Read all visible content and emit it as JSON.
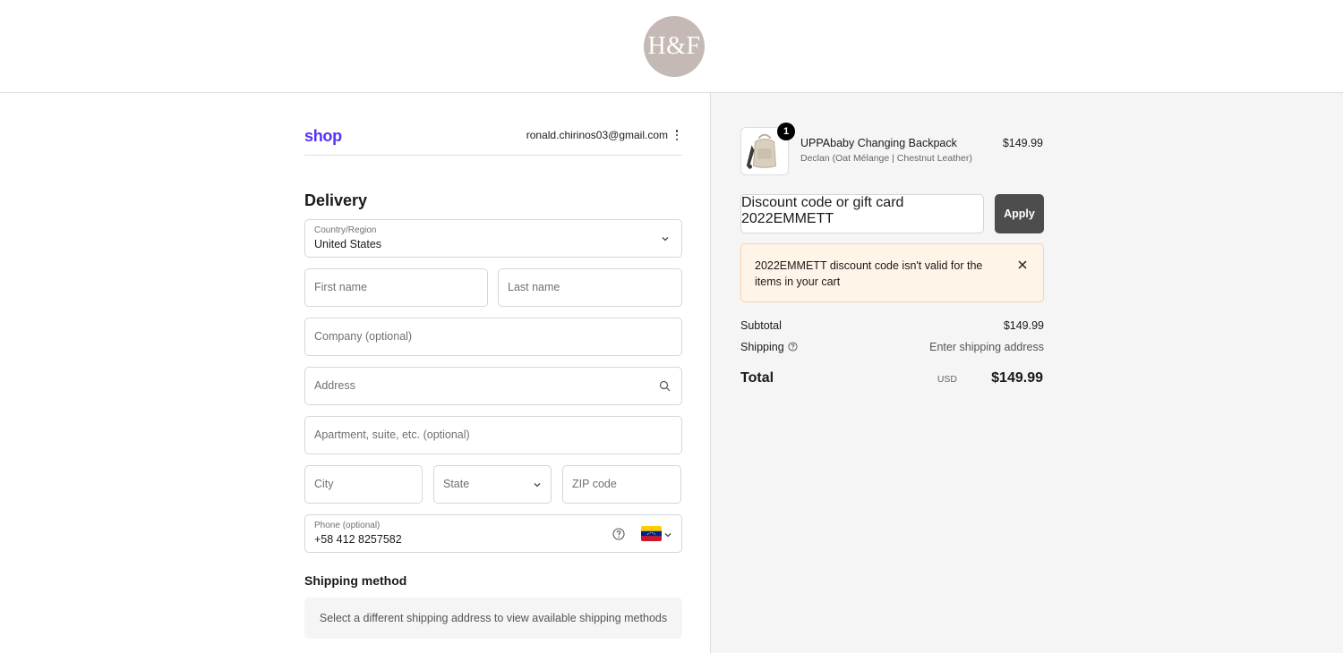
{
  "header": {
    "logo_text": "H&F"
  },
  "express": {
    "shop_label": "shop",
    "account_email": "ronald.chirinos03@gmail.com"
  },
  "delivery": {
    "title": "Delivery",
    "country": {
      "label": "Country/Region",
      "value": "United States"
    },
    "first_name": {
      "placeholder": "First name"
    },
    "last_name": {
      "placeholder": "Last name"
    },
    "company": {
      "placeholder": "Company (optional)"
    },
    "address": {
      "placeholder": "Address"
    },
    "apartment": {
      "placeholder": "Apartment, suite, etc. (optional)"
    },
    "city": {
      "placeholder": "City"
    },
    "state": {
      "placeholder": "State"
    },
    "zip": {
      "placeholder": "ZIP code"
    },
    "phone": {
      "label": "Phone (optional)",
      "value": "+58 412 8257582",
      "flag_icon": "venezuela-flag-icon"
    }
  },
  "shipping_method": {
    "title": "Shipping method",
    "message": "Select a different shipping address to view available shipping methods"
  },
  "summary": {
    "product": {
      "quantity": "1",
      "name": "UPPAbaby Changing Backpack",
      "variant": "Declan (Oat Mélange | Chestnut Leather)",
      "price": "$149.99"
    },
    "discount": {
      "label": "Discount code or gift card",
      "value": "2022EMMETT",
      "apply_label": "Apply"
    },
    "error": {
      "message": "2022EMMETT discount code isn't valid for the items in your cart"
    },
    "subtotal_label": "Subtotal",
    "subtotal_value": "$149.99",
    "shipping_label": "Shipping",
    "shipping_value": "Enter shipping address",
    "total_label": "Total",
    "total_currency": "USD",
    "total_value": "$149.99"
  },
  "colors": {
    "shop_brand": "#5a31f4",
    "apply_button": "#4d4d4d",
    "error_bg": "#fff4e8",
    "error_border": "#f8d3a6",
    "summary_bg": "#f5f5f5"
  }
}
